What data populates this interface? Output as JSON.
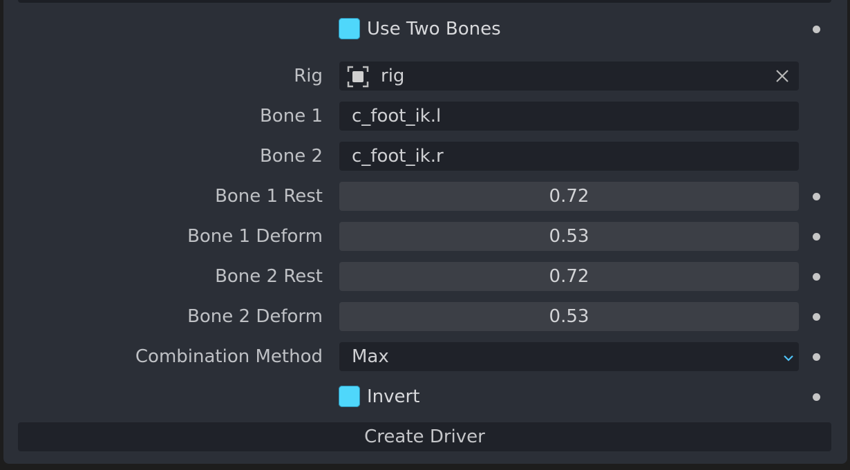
{
  "use_two_bones": {
    "label": "Use Two Bones",
    "checked": true
  },
  "rig": {
    "label": "Rig",
    "value": "rig",
    "icon": "object-icon",
    "clear_icon": "close-icon"
  },
  "bone1": {
    "label": "Bone 1",
    "value": "c_foot_ik.l"
  },
  "bone2": {
    "label": "Bone 2",
    "value": "c_foot_ik.r"
  },
  "bone1_rest": {
    "label": "Bone 1 Rest",
    "value": "0.72"
  },
  "bone1_deform": {
    "label": "Bone 1 Deform",
    "value": "0.53"
  },
  "bone2_rest": {
    "label": "Bone 2 Rest",
    "value": "0.72"
  },
  "bone2_deform": {
    "label": "Bone 2 Deform",
    "value": "0.53"
  },
  "combination_method": {
    "label": "Combination Method",
    "value": "Max",
    "icon": "chevron-down-icon"
  },
  "invert": {
    "label": "Invert",
    "checked": true
  },
  "create_driver": {
    "label": "Create Driver"
  },
  "colors": {
    "accent": "#4fd7fb",
    "panel": "#2b2f37",
    "field": "#1f2229",
    "number_field": "#3c3f46",
    "chevron": "#4fc3f7"
  }
}
